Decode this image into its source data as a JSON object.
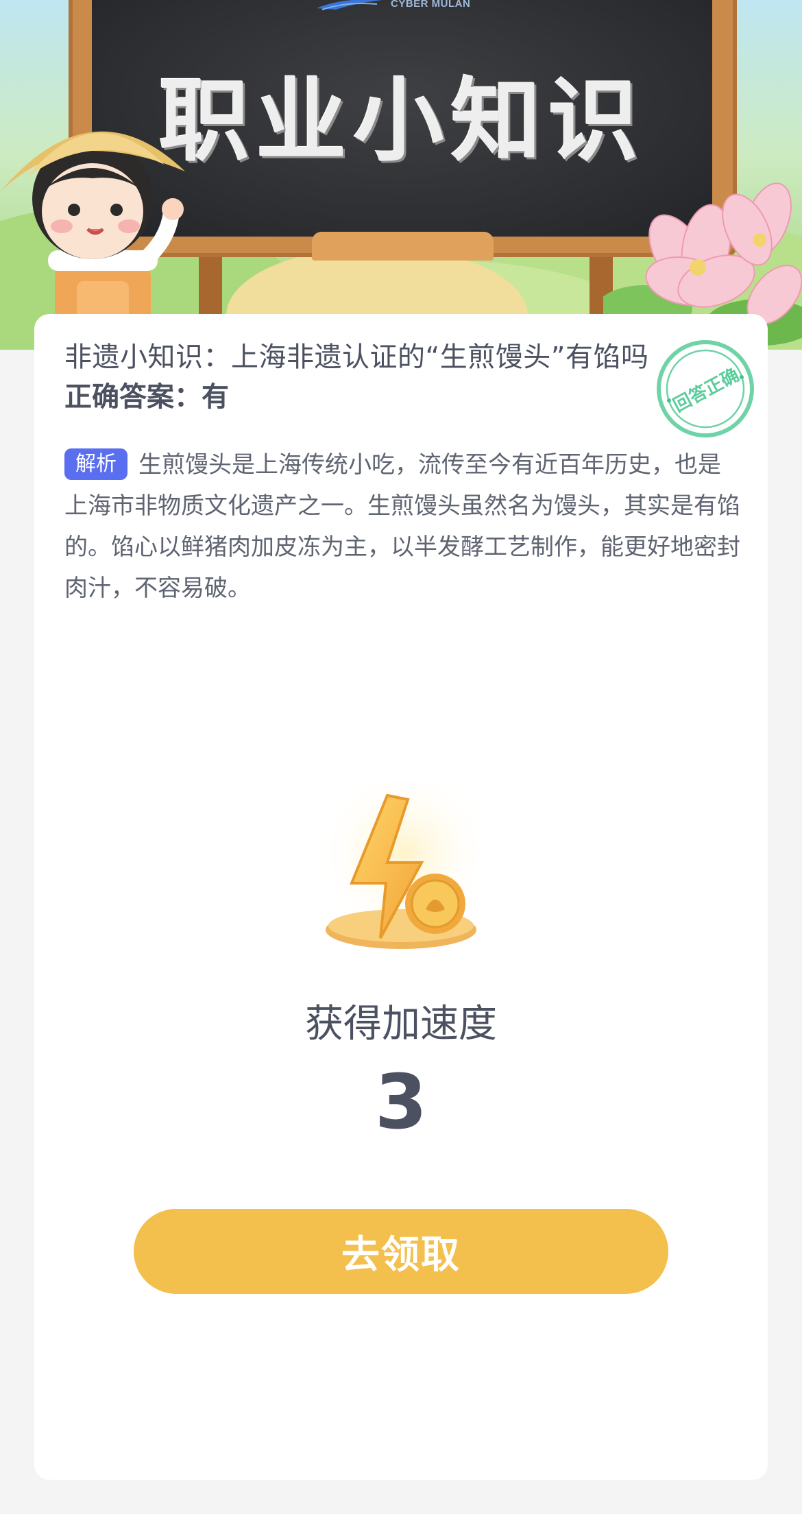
{
  "header": {
    "brand_text": "CYBER MULAN",
    "board_title": "职业小知识"
  },
  "quiz": {
    "question": "非遗小知识：上海非遗认证的“生煎馒头”有馅吗",
    "answer_label": "正确答案：",
    "answer_value": "有",
    "stamp_text": "回答正确",
    "analysis_tag": "解析",
    "analysis_text": "生煎馒头是上海传统小吃，流传至今有近百年历史，也是上海市非物质文化遗产之一。生煎馒头虽然名为馒头，其实是有馅的。馅心以鲜猪肉加皮冻为主，以半发酵工艺制作，能更好地密封肉汁，不容易破。"
  },
  "reward": {
    "label": "获得加速度",
    "value": "3",
    "claim_button_label": "去领取"
  },
  "colors": {
    "tag_bg": "#5a6ef0",
    "button_bg": "#f3bf4d",
    "stamp": "#3fc48a",
    "text": "#4b5161"
  },
  "icons": {
    "stamp": "correct-stamp-icon",
    "reward": "lightning-coin-icon",
    "mascot": "farmer-girl-illustration",
    "flowers": "magnolia-flowers-illustration"
  }
}
